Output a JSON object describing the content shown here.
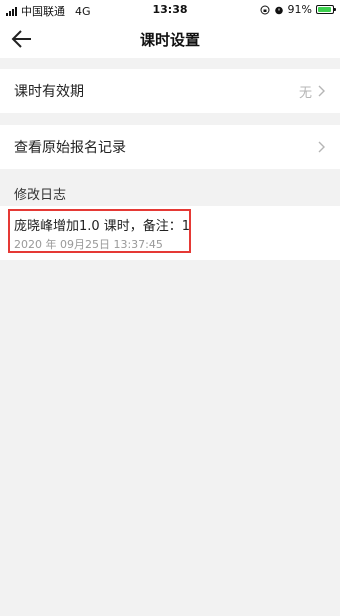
{
  "status_bar": {
    "carrier": "中国联通",
    "network": "4G",
    "time": "13:38",
    "battery": "91%",
    "battery_level": 0.91,
    "icons": [
      "signal-icon",
      "lock-rotation-icon",
      "alarm-icon",
      "battery-icon"
    ]
  },
  "nav": {
    "title": "课时设置",
    "back_icon": "arrow-left-icon"
  },
  "settings": [
    {
      "label": "课时有效期",
      "value": "无",
      "icon": "chevron-right-icon"
    },
    {
      "label": "查看原始报名记录",
      "value": "",
      "icon": "chevron-right-icon"
    }
  ],
  "log": {
    "header": "修改日志",
    "entries": [
      {
        "text": "庞晓峰增加1.0 课时，备注：1",
        "time": "2020 年 09月25日 13:37:45"
      }
    ]
  },
  "colors": {
    "highlight_border": "#e53935",
    "battery_fill": "#3ccf4e",
    "background": "#f2f2f2"
  }
}
